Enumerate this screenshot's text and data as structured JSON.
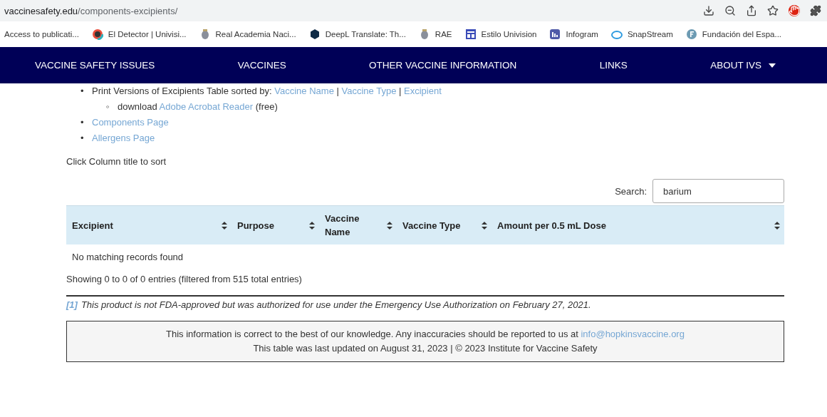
{
  "browser": {
    "url_domain": "vaccinesafety.edu",
    "url_path": "/components-excipients/",
    "bookmarks": [
      {
        "label": "Access to publicati...",
        "kind": "none"
      },
      {
        "label": "El Detector | Univisi...",
        "kind": "ring"
      },
      {
        "label": "Real Academia Naci...",
        "kind": "crest"
      },
      {
        "label": "DeepL Translate: Th...",
        "kind": "deepl"
      },
      {
        "label": "RAE",
        "kind": "crest"
      },
      {
        "label": "Estilo Univision",
        "kind": "layout"
      },
      {
        "label": "Infogram",
        "kind": "chart"
      },
      {
        "label": "SnapStream",
        "kind": "swirl"
      },
      {
        "label": "Fundación del Espa...",
        "kind": "letter-circle"
      }
    ]
  },
  "nav": [
    {
      "label": "VACCINE SAFETY ISSUES",
      "dropdown": false
    },
    {
      "label": "VACCINES",
      "dropdown": false
    },
    {
      "label": "OTHER VACCINE INFORMATION",
      "dropdown": false
    },
    {
      "label": "LINKS",
      "dropdown": false
    },
    {
      "label": "ABOUT IVS",
      "dropdown": true
    }
  ],
  "print_versions": {
    "marker": "•",
    "prefix": "Print Versions of Excipients Table sorted by:",
    "links": [
      "Vaccine Name",
      "Vaccine Type",
      "Excipient"
    ],
    "separator": "|"
  },
  "download": {
    "marker": "◦",
    "prefix": "download",
    "link": "Adobe Acrobat Reader",
    "suffix": "(free)"
  },
  "page_links": [
    {
      "marker": "•",
      "label": "Components Page"
    },
    {
      "marker": "•",
      "label": "Allergens Page"
    }
  ],
  "sort_hint": "Click Column title to sort",
  "search": {
    "label": "Search:",
    "value": "barium"
  },
  "table": {
    "columns": [
      "Excipient",
      "Purpose",
      "Vaccine Name",
      "Vaccine Type",
      "Amount per 0.5 mL Dose"
    ],
    "empty_message": "No matching records found"
  },
  "info": "Showing 0 to 0 of 0 entries (filtered from 515 total entries)",
  "footnote": {
    "mark": "[1]",
    "text": "This product is not FDA-approved but was authorized for use under the Emergency Use Authorization on February 27, 2021."
  },
  "footer": {
    "line_1": "This information is correct to the best of our knowledge. Any inaccuracies should be reported to us at",
    "email": "info@hopkinsvaccine.org",
    "line_2": "This table was last updated on August 31, 2023 | © 2023 Institute for Vaccine Safety"
  }
}
